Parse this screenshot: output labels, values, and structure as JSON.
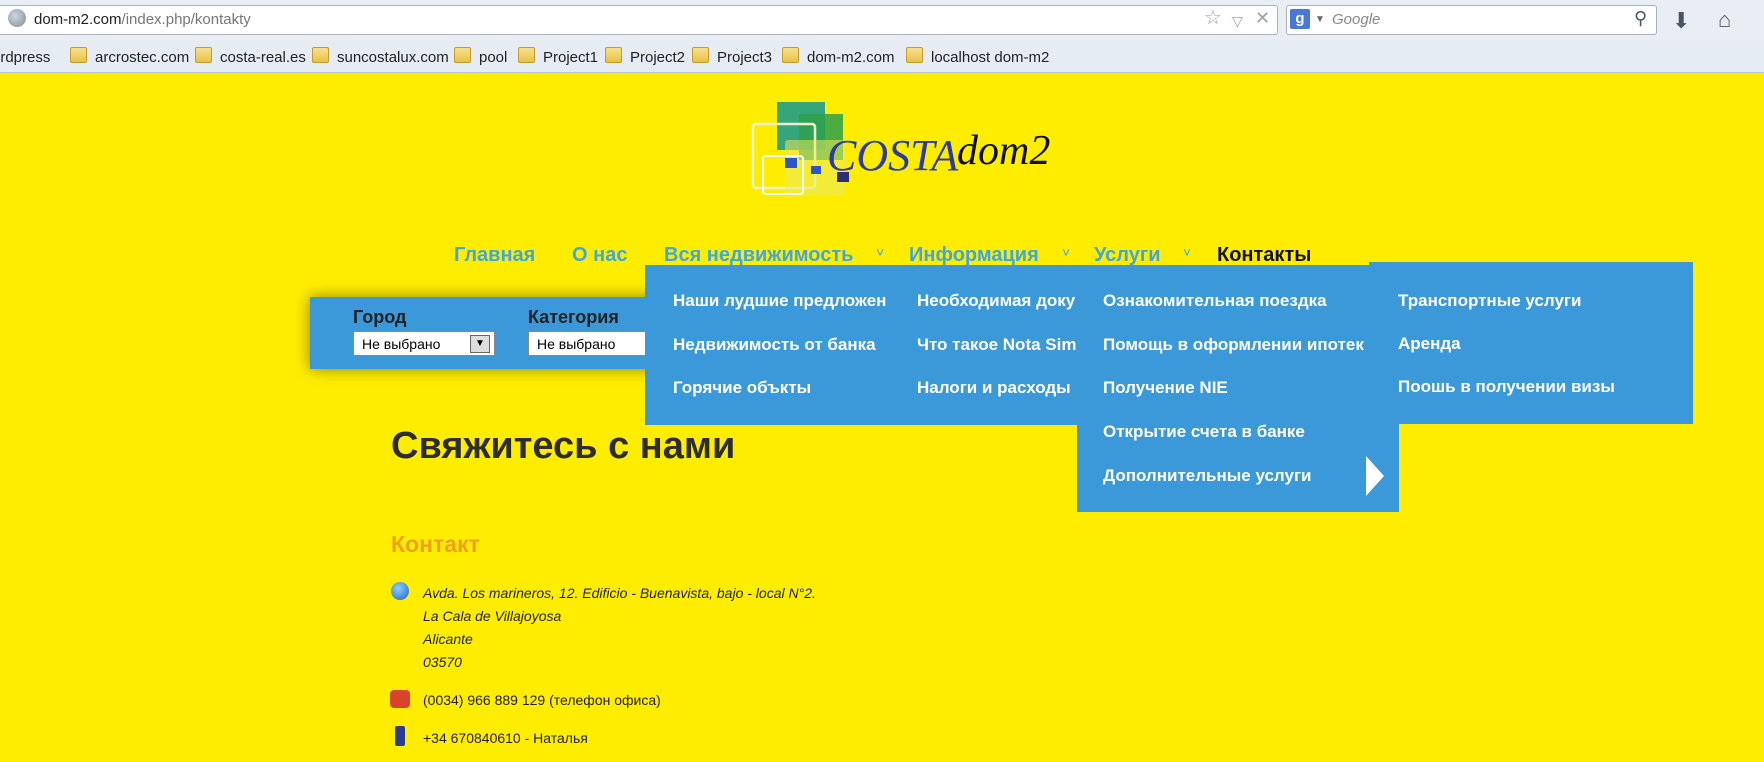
{
  "browser": {
    "url_host": "dom-m2.com",
    "url_path": "/index.php/kontakty",
    "search_placeholder": "Google",
    "bookmarks": [
      "ordpress",
      "arcrostec.com",
      "costa-real.es",
      "suncostalux.com",
      "pool",
      "Project1",
      "Project2",
      "Project3",
      "dom-m2.com",
      "localhost dom-m2"
    ]
  },
  "logo": {
    "part1": "COSTA",
    "part2": "dom2"
  },
  "nav": [
    "Главная",
    "О нас",
    "Вся недвижимость",
    "Информация",
    "Услуги",
    "Контакты"
  ],
  "filter": {
    "city_label": "Город",
    "city_value": "Не выбрано",
    "category_label": "Категория",
    "category_value": "Не выбрано"
  },
  "dropdowns": {
    "property": [
      "Наши лудшие предложен",
      "Недвижимость от банка",
      "Горячие объкты"
    ],
    "info": [
      "Необходимая доку",
      "Что такое Nota Simp",
      "Налоги и расходы"
    ],
    "services": [
      "Ознакомительная поездка",
      "Помощь в оформлении ипотек",
      "Получение NIE",
      "Открытие счета в банке",
      "Дополнительные услуги"
    ],
    "extra": [
      "Транспортные услуги",
      "Аренда",
      "Поошь в получении визы"
    ]
  },
  "page": {
    "title": "Свяжитесь с нами",
    "contact_heading": "Контакт",
    "address": [
      "Avda. Los marineros, 12. Edificio - Buenavista, bajo - local N°2.",
      "La Cala de Villajoyosa",
      "Alicante",
      "03570"
    ],
    "phone_office": "(0034) 966 889 129 (телефон офиса)",
    "phone_mobile": "+34 670840610 - Наталья"
  },
  "colors": {
    "page_bg": "#ffed00",
    "menu_blue": "#3b99d9",
    "nav_link": "#3ea7df",
    "accent_orange": "#f0a020"
  }
}
